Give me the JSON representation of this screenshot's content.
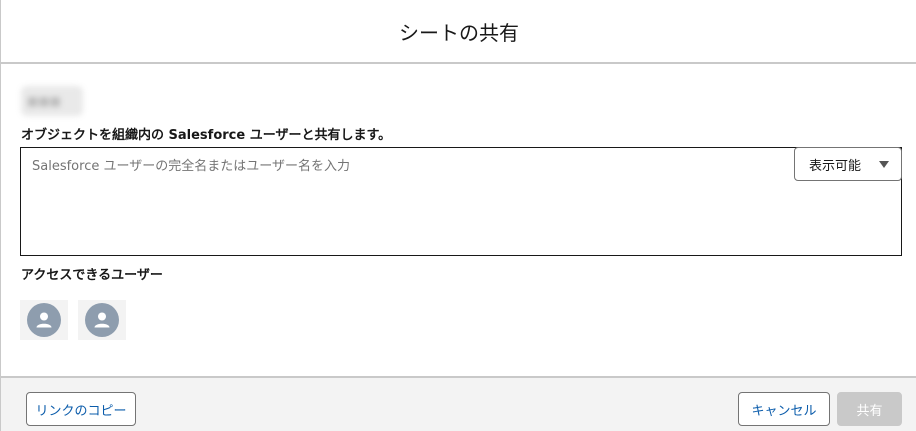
{
  "dialog": {
    "title": "シートの共有",
    "owner_name_blurred": "■■■"
  },
  "share": {
    "label": "オブジェクトを組織内の Salesforce ユーザーと共有します。",
    "input_value": "",
    "input_placeholder": "Salesforce ユーザーの完全名またはユーザー名を入力",
    "permission_selected": "表示可能"
  },
  "access": {
    "label": "アクセスできるユーザー",
    "users": [
      {
        "icon": "user-icon"
      },
      {
        "icon": "user-icon"
      }
    ]
  },
  "footer": {
    "copy_link_label": "リンクのコピー",
    "cancel_label": "キャンセル",
    "share_label": "共有"
  },
  "colors": {
    "link_blue": "#0b5cab",
    "avatar_gray": "#8e9dae",
    "disabled_button": "#c9c9c9",
    "border": "#c9c9c9"
  }
}
